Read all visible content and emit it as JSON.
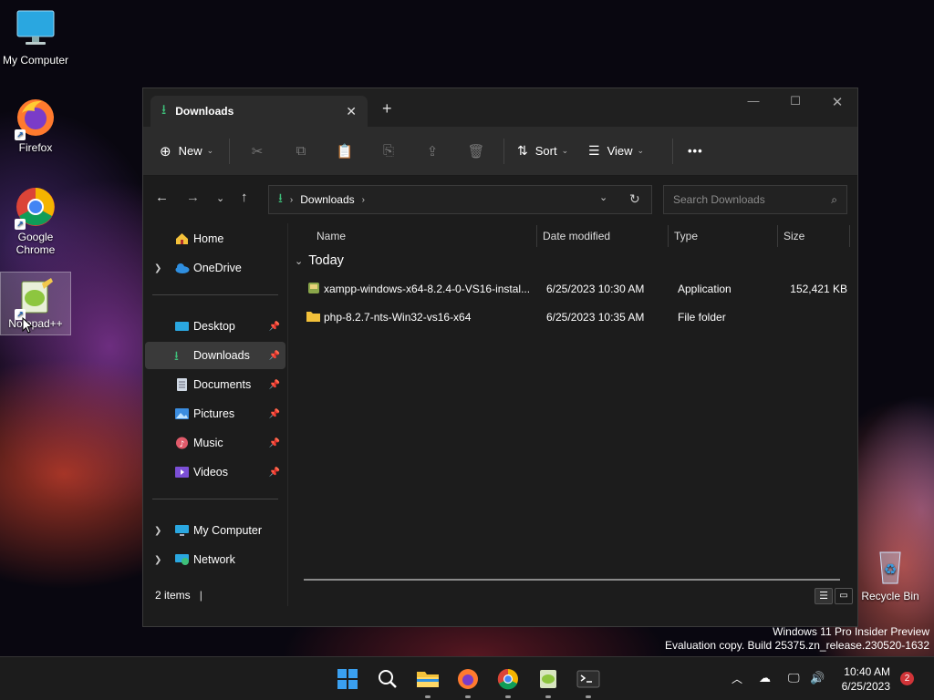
{
  "desktop": {
    "icons": [
      {
        "label": "My Computer"
      },
      {
        "label": "Firefox"
      },
      {
        "label": "Google Chrome"
      },
      {
        "label": "Notepad++"
      },
      {
        "label": "Recycle Bin"
      }
    ],
    "watermark": {
      "line1": "Windows 11 Pro Insider Preview",
      "line2": "Evaluation copy. Build 25375.zn_release.230520-1632"
    }
  },
  "window": {
    "tab_title": "Downloads",
    "toolbar": {
      "new_label": "New",
      "sort_label": "Sort",
      "view_label": "View",
      "more_label": "•••"
    },
    "address": {
      "crumb": "Downloads",
      "search_placeholder": "Search Downloads"
    },
    "sidebar": {
      "items": [
        {
          "label": "Home"
        },
        {
          "label": "OneDrive"
        },
        {
          "label": "Desktop"
        },
        {
          "label": "Downloads"
        },
        {
          "label": "Documents"
        },
        {
          "label": "Pictures"
        },
        {
          "label": "Music"
        },
        {
          "label": "Videos"
        },
        {
          "label": "My Computer"
        },
        {
          "label": "Network"
        }
      ]
    },
    "columns": [
      "Name",
      "Date modified",
      "Type",
      "Size"
    ],
    "group_label": "Today",
    "files": [
      {
        "name": "xampp-windows-x64-8.2.4-0-VS16-instal...",
        "date": "6/25/2023 10:30 AM",
        "type": "Application",
        "size": "152,421 KB"
      },
      {
        "name": "php-8.2.7-nts-Win32-vs16-x64",
        "date": "6/25/2023 10:35 AM",
        "type": "File folder",
        "size": ""
      }
    ],
    "status": "2 items"
  },
  "taskbar": {
    "time": "10:40 AM",
    "date": "6/25/2023",
    "notification_count": "2"
  },
  "colors": {
    "accent_green": "#3ec07a",
    "folder_yellow": "#f3c13a",
    "onedrive_blue": "#2f8fe0",
    "notification_red": "#d13438"
  }
}
